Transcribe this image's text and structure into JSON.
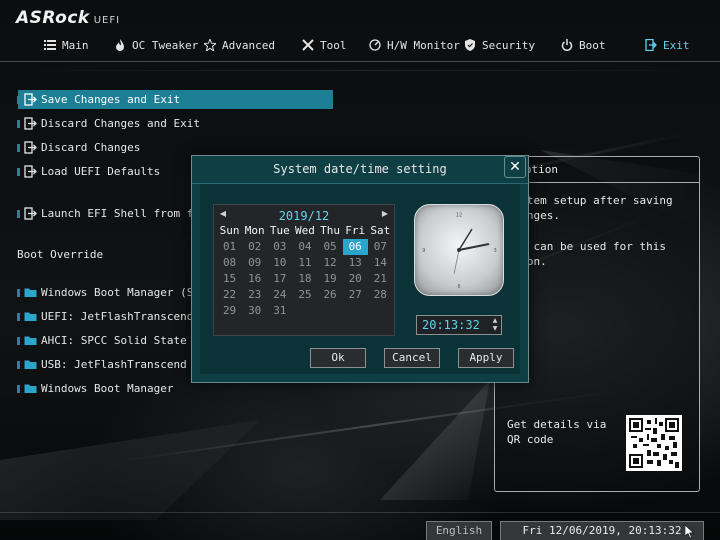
{
  "brand": {
    "name": "ASRock",
    "suffix": "UEFI"
  },
  "nav": {
    "tabs": [
      {
        "label": "Main",
        "icon": "list-icon"
      },
      {
        "label": "OC Tweaker",
        "icon": "flame-icon"
      },
      {
        "label": "Advanced",
        "icon": "star-icon"
      },
      {
        "label": "Tool",
        "icon": "tools-icon"
      },
      {
        "label": "H/W Monitor",
        "icon": "gauge-icon"
      },
      {
        "label": "Security",
        "icon": "shield-icon"
      },
      {
        "label": "Boot",
        "icon": "power-icon"
      },
      {
        "label": "Exit",
        "icon": "exit-icon"
      }
    ],
    "active": "Exit"
  },
  "menu": {
    "items": [
      {
        "label": "Save Changes and Exit",
        "icon": "exit-icon"
      },
      {
        "label": "Discard Changes and Exit",
        "icon": "exit-icon"
      },
      {
        "label": "Discard Changes",
        "icon": "exit-icon"
      },
      {
        "label": "Load UEFI Defaults",
        "icon": "exit-icon"
      },
      {
        "label": "Launch EFI Shell from file",
        "icon": "exit-icon"
      }
    ],
    "boot_override_title": "Boot Override",
    "boot_items": [
      {
        "label": "Windows Boot Manager (SPCC",
        "icon": "folder-icon"
      },
      {
        "label": "UEFI: JetFlashTranscend 8G",
        "icon": "folder-icon"
      },
      {
        "label": "AHCI:  SPCC Solid State Di",
        "icon": "folder-icon"
      },
      {
        "label": "USB: JetFlashTranscend 8GB",
        "icon": "folder-icon"
      },
      {
        "label": "Windows Boot Manager",
        "icon": "folder-icon"
      }
    ]
  },
  "description": {
    "header": "cription",
    "text1": "system setup after saving\nchanges.",
    "text2": "key can be used for this\nation.",
    "qr_text": "Get details via QR code"
  },
  "dialog": {
    "title": "System date/time setting",
    "close_label": "✕",
    "calendar": {
      "month_label": "2019/12",
      "weekdays": [
        "Sun",
        "Mon",
        "Tue",
        "Wed",
        "Thu",
        "Fri",
        "Sat"
      ],
      "weeks": [
        [
          "01",
          "02",
          "03",
          "04",
          "05",
          "06",
          "07"
        ],
        [
          "08",
          "09",
          "10",
          "11",
          "12",
          "13",
          "14"
        ],
        [
          "15",
          "16",
          "17",
          "18",
          "19",
          "20",
          "21"
        ],
        [
          "22",
          "23",
          "24",
          "25",
          "26",
          "27",
          "28"
        ],
        [
          "29",
          "30",
          "31",
          "",
          "",
          "",
          ""
        ]
      ],
      "selected_day": "06"
    },
    "time_value": "20:13:32",
    "buttons": {
      "ok": "Ok",
      "cancel": "Cancel",
      "apply": "Apply"
    }
  },
  "bottom": {
    "language": "English",
    "datetime": "Fri 12/06/2019, 20:13:32"
  },
  "colors": {
    "accent": "#5fd4f0",
    "selection": "#1d7f95",
    "dialog": "#0e3f45"
  }
}
